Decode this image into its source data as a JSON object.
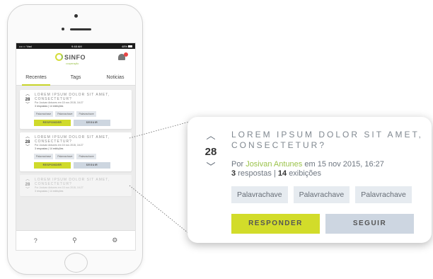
{
  "status_bar": {
    "carrier": "•••○○ Yast",
    "time": "9:48 AM",
    "battery": "48%"
  },
  "app": {
    "logo_text": "SINFO",
    "logo_subtitle": "cooperação"
  },
  "tabs": [
    {
      "label": "Recentes",
      "active": true
    },
    {
      "label": "Tags",
      "active": false
    },
    {
      "label": "Noticias",
      "active": false
    }
  ],
  "question": {
    "votes": "28",
    "title": "LOREM IPSUM DOLOR SIT AMET, CONSECTETUR?",
    "meta_prefix": "Por",
    "author": "Josivan Antunes",
    "meta_suffix": "em 15 nov 2015, 16:27",
    "answers_count": "3",
    "answers_label": "respostas",
    "views_count": "14",
    "views_label": "exibições",
    "tags": [
      "Palavrachave",
      "Palavrachave",
      "Palavrachave"
    ],
    "reply_label": "RESPONDER",
    "follow_label": "SEGUIR"
  },
  "phone_question": {
    "meta": "Por Josivan Antunes em 15 nov 2015, 16:27",
    "stats": "3 respostas | 14 exibições"
  },
  "bottom_nav": {
    "help": "?",
    "search": "⚲",
    "settings": "⚙"
  },
  "colors": {
    "accent": "#cfda2b",
    "author": "#9bc34a",
    "secondary_button": "#cdd6e0"
  }
}
